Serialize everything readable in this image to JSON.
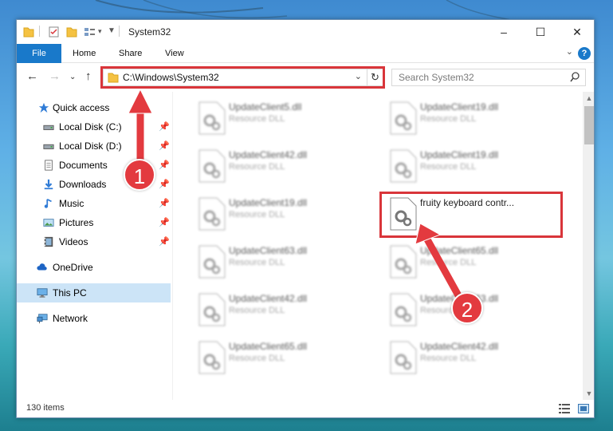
{
  "window": {
    "title": "System32",
    "controls": {
      "minimize": "–",
      "maximize": "☐",
      "close": "✕"
    }
  },
  "ribbon": {
    "tabs": [
      "File",
      "Home",
      "Share",
      "View"
    ],
    "help": "?"
  },
  "navigation": {
    "address": "C:\\Windows\\System32",
    "search_placeholder": "Search System32"
  },
  "sidebar": {
    "items": [
      {
        "label": "Quick access",
        "icon": "star-icon",
        "pinned": false
      },
      {
        "label": "Local Disk (C:)",
        "icon": "drive-icon",
        "pinned": true
      },
      {
        "label": "Local Disk (D:)",
        "icon": "drive-icon",
        "pinned": true
      },
      {
        "label": "Documents",
        "icon": "documents-icon",
        "pinned": true
      },
      {
        "label": "Downloads",
        "icon": "download-icon",
        "pinned": true
      },
      {
        "label": "Music",
        "icon": "music-icon",
        "pinned": true
      },
      {
        "label": "Pictures",
        "icon": "pictures-icon",
        "pinned": true
      },
      {
        "label": "Videos",
        "icon": "videos-icon",
        "pinned": true
      },
      {
        "label": "OneDrive",
        "icon": "cloud-icon",
        "pinned": false
      },
      {
        "label": "This PC",
        "icon": "computer-icon",
        "pinned": false,
        "selected": true
      },
      {
        "label": "Network",
        "icon": "network-icon",
        "pinned": false
      }
    ]
  },
  "files": [
    {
      "name": "UpdateClient5.dll",
      "type": "Resource DLL"
    },
    {
      "name": "UpdateClient19.dll",
      "type": "Resource DLL"
    },
    {
      "name": "UpdateClient42.dll",
      "type": "Resource DLL"
    },
    {
      "name": "UpdateClient19.dll",
      "type": "Resource DLL"
    },
    {
      "name": "UpdateClient19.dll",
      "type": "Resource DLL"
    },
    {
      "name": "fruity keyboard contr...",
      "type": "",
      "highlighted": true
    },
    {
      "name": "UpdateClient63.dll",
      "type": "Resource DLL"
    },
    {
      "name": "UpdateClient65.dll",
      "type": "Resource DLL"
    },
    {
      "name": "UpdateClient42.dll",
      "type": "Resource DLL"
    },
    {
      "name": "UpdateClient63.dll",
      "type": "Resource DLL"
    },
    {
      "name": "UpdateClient65.dll",
      "type": "Resource DLL"
    },
    {
      "name": "UpdateClient42.dll",
      "type": "Resource DLL"
    }
  ],
  "status": {
    "item_count": "130 items"
  },
  "annotations": {
    "step1": "1",
    "step2": "2",
    "highlight_color": "#d9353a"
  }
}
